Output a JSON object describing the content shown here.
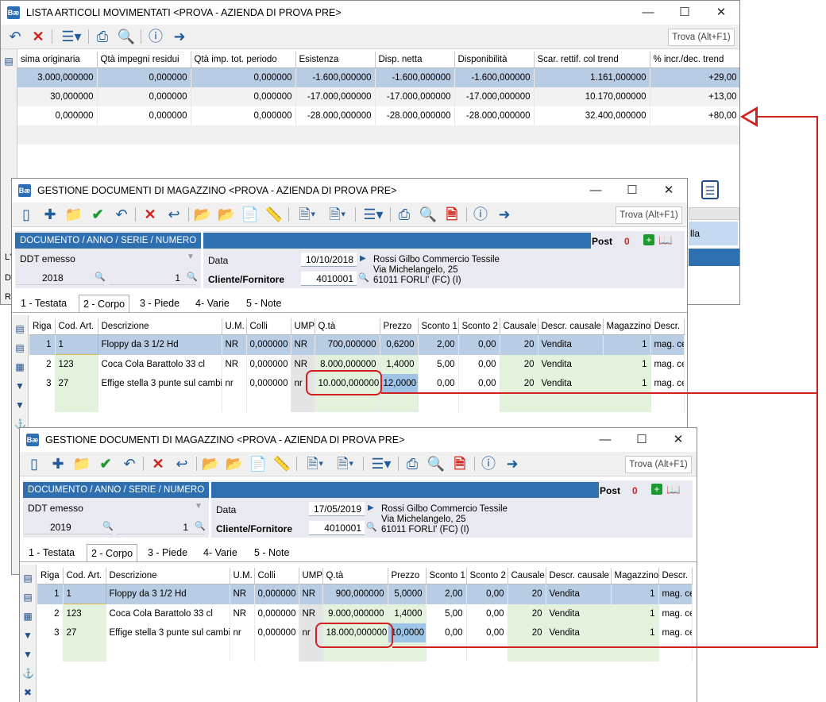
{
  "w1": {
    "title": "LISTA ARTICOLI MOVIMENTATI <PROVA - AZIENDA DI PROVA PRE>",
    "icon_label": "Bæ",
    "find": "Trova (Alt+F1)",
    "columns": [
      "sima originaria",
      "Qtà impegni residui",
      "Qtà imp. tot. periodo",
      "Esistenza",
      "Disp. netta",
      "Disponibilità",
      "Scar. rettif. col trend",
      "% incr./dec. trend"
    ],
    "rows": [
      [
        "3.000,000000",
        "0,000000",
        "0,000000",
        "-1.600,000000",
        "-1.600,000000",
        "-1.600,000000",
        "1.161,000000",
        "+29,00"
      ],
      [
        "30,000000",
        "0,000000",
        "0,000000",
        "-17.000,000000",
        "-17.000,000000",
        "-17.000,000000",
        "10.170,000000",
        "+13,00"
      ],
      [
        "0,000000",
        "0,000000",
        "0,000000",
        "-28.000,000000",
        "-28.000,000000",
        "-28.000,000000",
        "32.400,000000",
        "+80,00"
      ]
    ],
    "side_text": [
      "L'",
      "D",
      "Ri"
    ],
    "right_label": "lla"
  },
  "w2": {
    "title": "GESTIONE DOCUMENTI DI MAGAZZINO <PROVA - AZIENDA DI PROVA PRE>",
    "find": "Trova (Alt+F1)",
    "doc_header": "DOCUMENTO / ANNO / SERIE / NUMERO",
    "doc_type": "DDT emesso",
    "year": "2018",
    "number": "1",
    "post_label": "Post",
    "post_value": "0",
    "date_label": "Data",
    "date_value": "10/10/2018",
    "client_label": "Cliente/Fornitore",
    "client_code": "4010001",
    "client_name": "Rossi Gilbo  Commercio Tessile",
    "client_addr": "Via Michelangelo, 25",
    "client_city": "61011 FORLI' (FC)   (I)",
    "tabs": [
      "1 - Testata",
      "2 - Corpo",
      "3 - Piede",
      "4- Varie",
      "5 - Note"
    ],
    "columns": [
      "Riga",
      "Cod. Art.",
      "Descrizione",
      "U.M.",
      "Colli",
      "UMP",
      "Q.tà",
      "Prezzo",
      "Sconto 1",
      "Sconto 2",
      "Causale",
      "Descr. causale",
      "Magazzino",
      "Descr."
    ],
    "rows": [
      [
        "1",
        "1",
        "Floppy da 3 1/2 Hd",
        "NR",
        "0,000000",
        "NR",
        "700,000000",
        "0,6200",
        "2,00",
        "0,00",
        "20",
        "Vendita",
        "1",
        "mag. ce"
      ],
      [
        "2",
        "123",
        "Coca Cola Barattolo 33 cl",
        "NR",
        "0,000000",
        "NR",
        "8.000,000000",
        "1,4000",
        "5,00",
        "0,00",
        "20",
        "Vendita",
        "1",
        "mag. ce"
      ],
      [
        "3",
        "27",
        "Effige stella 3 punte sul cambio",
        "nr",
        "0,000000",
        "nr",
        "10.000,000000",
        "12,0000",
        "0,00",
        "0,00",
        "20",
        "Vendita",
        "1",
        "mag. ce"
      ]
    ]
  },
  "w3": {
    "title": "GESTIONE DOCUMENTI DI MAGAZZINO <PROVA - AZIENDA DI PROVA PRE>",
    "find": "Trova (Alt+F1)",
    "doc_header": "DOCUMENTO / ANNO / SERIE / NUMERO",
    "doc_type": "DDT emesso",
    "year": "2019",
    "number": "1",
    "post_label": "Post",
    "post_value": "0",
    "date_label": "Data",
    "date_value": "17/05/2019",
    "client_label": "Cliente/Fornitore",
    "client_code": "4010001",
    "client_name": "Rossi Gilbo  Commercio Tessile",
    "client_addr": "Via Michelangelo, 25",
    "client_city": "61011 FORLI' (FC)   (I)",
    "tabs": [
      "1 - Testata",
      "2 - Corpo",
      "3 - Piede",
      "4- Varie",
      "5 - Note"
    ],
    "columns": [
      "Riga",
      "Cod. Art.",
      "Descrizione",
      "U.M.",
      "Colli",
      "UMP",
      "Q.tà",
      "Prezzo",
      "Sconto 1",
      "Sconto 2",
      "Causale",
      "Descr. causale",
      "Magazzino",
      "Descr."
    ],
    "rows": [
      [
        "1",
        "1",
        "Floppy da 3 1/2 Hd",
        "NR",
        "0,000000",
        "NR",
        "900,000000",
        "5,0000",
        "2,00",
        "0,00",
        "20",
        "Vendita",
        "1",
        "mag. ce"
      ],
      [
        "2",
        "123",
        "Coca Cola Barattolo 33 cl",
        "NR",
        "0,000000",
        "NR",
        "9.000,000000",
        "1,4000",
        "5,00",
        "0,00",
        "20",
        "Vendita",
        "1",
        "mag. ce"
      ],
      [
        "3",
        "27",
        "Effige stella 3 punte sul cambio",
        "nr",
        "0,000000",
        "nr",
        "18.000,000000",
        "10,0000",
        "0,00",
        "0,00",
        "20",
        "Vendita",
        "1",
        "mag. ce"
      ]
    ]
  },
  "colors": {
    "annotation": "#d21f1f",
    "header_blue": "#2e6fb0",
    "selection": "#b8cce4"
  }
}
